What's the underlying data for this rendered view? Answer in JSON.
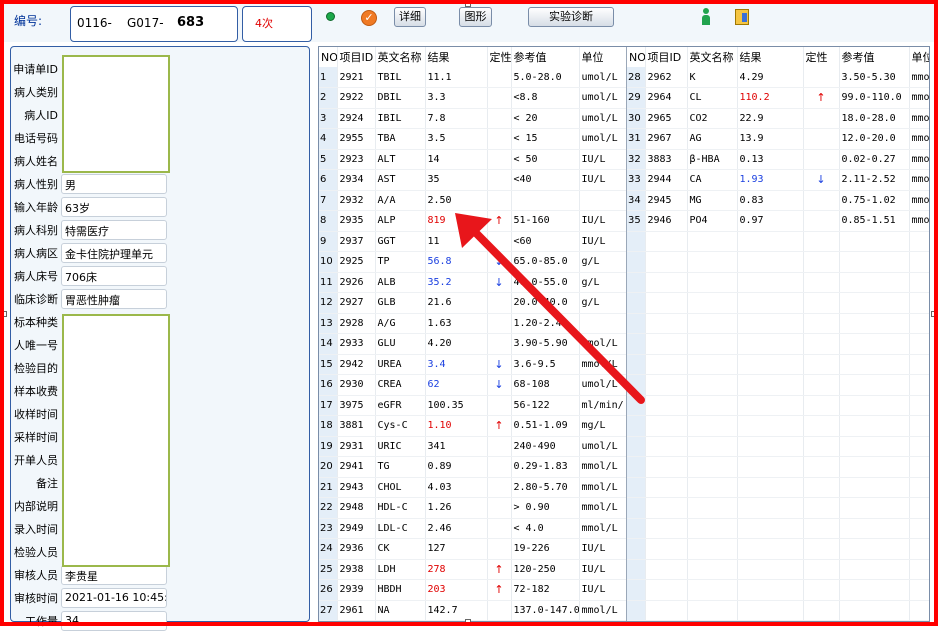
{
  "header": {
    "code_label": "编号:",
    "code_part1": "0116-",
    "code_part2": "G017-",
    "code_part3": "683",
    "count": "4次",
    "detail_button": "详细",
    "graph_button": "图形",
    "diagnosis_button": "实验诊断"
  },
  "patient": {
    "labels": {
      "request_id": "申请单ID",
      "patient_type": "病人类别",
      "patient_id": "病人ID",
      "phone": "电话号码",
      "name": "病人姓名",
      "sex": "病人性别",
      "age": "输入年龄",
      "dept": "病人科别",
      "ward": "病人病区",
      "bed": "病人床号",
      "diagnosis": "临床诊断",
      "specimen": "标本种类",
      "unique_no": "人唯一号",
      "purpose": "检验目的",
      "fee": "样本收费",
      "receive_time": "收样时间",
      "collect_time": "采样时间",
      "issuer": "开单人员",
      "remark": "备注",
      "internal_note": "内部说明",
      "entry_time": "录入时间",
      "tester": "检验人员",
      "reviewer": "审核人员",
      "review_time": "审核时间",
      "workload": "工作量"
    },
    "values": {
      "sex": "男",
      "age": "63岁",
      "dept": "特需医疗",
      "ward": "金卡住院护理单元",
      "bed": "706床",
      "diagnosis": "胃恶性肿瘤",
      "reviewer": "李贵星",
      "review_time": "2021-01-16 10:45:3",
      "workload": "34"
    }
  },
  "table": {
    "headers": [
      "NO",
      "项目ID",
      "英文名称",
      "结果",
      "定性",
      "参考值",
      "单位"
    ],
    "left_rows": [
      {
        "no": "1",
        "id": "2921",
        "name": "TBIL",
        "result": "11.1",
        "flag": "",
        "ref": "5.0-28.0",
        "unit": "umol/L",
        "color": "#000000"
      },
      {
        "no": "2",
        "id": "2922",
        "name": "DBIL",
        "result": "3.3",
        "flag": "",
        "ref": "<8.8",
        "unit": "umol/L",
        "color": "#000000"
      },
      {
        "no": "3",
        "id": "2924",
        "name": "IBIL",
        "result": "7.8",
        "flag": "",
        "ref": "< 20",
        "unit": "umol/L",
        "color": "#000000"
      },
      {
        "no": "4",
        "id": "2955",
        "name": "TBA",
        "result": "3.5",
        "flag": "",
        "ref": "< 15",
        "unit": "umol/L",
        "color": "#000000"
      },
      {
        "no": "5",
        "id": "2923",
        "name": "ALT",
        "result": "14",
        "flag": "",
        "ref": "< 50",
        "unit": "IU/L",
        "color": "#000000"
      },
      {
        "no": "6",
        "id": "2934",
        "name": "AST",
        "result": "35",
        "flag": "",
        "ref": "<40",
        "unit": "IU/L",
        "color": "#000000"
      },
      {
        "no": "7",
        "id": "2932",
        "name": "A/A",
        "result": "2.50",
        "flag": "",
        "ref": "",
        "unit": "",
        "color": "#000000"
      },
      {
        "no": "8",
        "id": "2935",
        "name": "ALP",
        "result": "819",
        "flag": "↑",
        "ref": "51-160",
        "unit": "IU/L",
        "color": "#e00000"
      },
      {
        "no": "9",
        "id": "2937",
        "name": "GGT",
        "result": "11",
        "flag": "",
        "ref": "<60",
        "unit": "IU/L",
        "color": "#000000"
      },
      {
        "no": "10",
        "id": "2925",
        "name": "TP",
        "result": "56.8",
        "flag": "↓",
        "ref": "65.0-85.0",
        "unit": "g/L",
        "color": "#1a3fe0"
      },
      {
        "no": "11",
        "id": "2926",
        "name": "ALB",
        "result": "35.2",
        "flag": "↓",
        "ref": "40.0-55.0",
        "unit": "g/L",
        "color": "#1a3fe0"
      },
      {
        "no": "12",
        "id": "2927",
        "name": "GLB",
        "result": "21.6",
        "flag": "",
        "ref": "20.0-40.0",
        "unit": "g/L",
        "color": "#000000"
      },
      {
        "no": "13",
        "id": "2928",
        "name": "A/G",
        "result": "1.63",
        "flag": "",
        "ref": "1.20-2.40",
        "unit": "",
        "color": "#000000"
      },
      {
        "no": "14",
        "id": "2933",
        "name": "GLU",
        "result": "4.20",
        "flag": "",
        "ref": "3.90-5.90",
        "unit": "mmol/L",
        "color": "#000000"
      },
      {
        "no": "15",
        "id": "2942",
        "name": "UREA",
        "result": "3.4",
        "flag": "↓",
        "ref": "3.6-9.5",
        "unit": "mmol/L",
        "color": "#1a3fe0"
      },
      {
        "no": "16",
        "id": "2930",
        "name": "CREA",
        "result": "62",
        "flag": "↓",
        "ref": "68-108",
        "unit": "umol/L",
        "color": "#1a3fe0"
      },
      {
        "no": "17",
        "id": "3975",
        "name": "eGFR",
        "result": "100.35",
        "flag": "",
        "ref": "56-122",
        "unit": "ml/min/",
        "color": "#000000"
      },
      {
        "no": "18",
        "id": "3881",
        "name": "Cys-C",
        "result": "1.10",
        "flag": "↑",
        "ref": "0.51-1.09",
        "unit": "mg/L",
        "color": "#e00000"
      },
      {
        "no": "19",
        "id": "2931",
        "name": "URIC",
        "result": "341",
        "flag": "",
        "ref": "240-490",
        "unit": "umol/L",
        "color": "#000000"
      },
      {
        "no": "20",
        "id": "2941",
        "name": "TG",
        "result": "0.89",
        "flag": "",
        "ref": "0.29-1.83",
        "unit": "mmol/L",
        "color": "#000000"
      },
      {
        "no": "21",
        "id": "2943",
        "name": "CHOL",
        "result": "4.03",
        "flag": "",
        "ref": "2.80-5.70",
        "unit": "mmol/L",
        "color": "#000000"
      },
      {
        "no": "22",
        "id": "2948",
        "name": "HDL-C",
        "result": "1.26",
        "flag": "",
        "ref": "> 0.90",
        "unit": "mmol/L",
        "color": "#000000"
      },
      {
        "no": "23",
        "id": "2949",
        "name": "LDL-C",
        "result": "2.46",
        "flag": "",
        "ref": "< 4.0",
        "unit": "mmol/L",
        "color": "#000000"
      },
      {
        "no": "24",
        "id": "2936",
        "name": "CK",
        "result": "127",
        "flag": "",
        "ref": "19-226",
        "unit": "IU/L",
        "color": "#000000"
      },
      {
        "no": "25",
        "id": "2938",
        "name": "LDH",
        "result": "278",
        "flag": "↑",
        "ref": "120-250",
        "unit": "IU/L",
        "color": "#e00000"
      },
      {
        "no": "26",
        "id": "2939",
        "name": "HBDH",
        "result": "203",
        "flag": "↑",
        "ref": "72-182",
        "unit": "IU/L",
        "color": "#e00000"
      },
      {
        "no": "27",
        "id": "2961",
        "name": "NA",
        "result": "142.7",
        "flag": "",
        "ref": "137.0-147.0",
        "unit": "mmol/L",
        "color": "#000000"
      }
    ],
    "right_rows": [
      {
        "no": "28",
        "id": "2962",
        "name": "K",
        "result": "4.29",
        "flag": "",
        "ref": "3.50-5.30",
        "unit": "mmol/L",
        "color": "#000000"
      },
      {
        "no": "29",
        "id": "2964",
        "name": "CL",
        "result": "110.2",
        "flag": "↑",
        "ref": "99.0-110.0",
        "unit": "mmol/L",
        "color": "#e00000"
      },
      {
        "no": "30",
        "id": "2965",
        "name": "CO2",
        "result": "22.9",
        "flag": "",
        "ref": "18.0-28.0",
        "unit": "mmol/L",
        "color": "#000000"
      },
      {
        "no": "31",
        "id": "2967",
        "name": "AG",
        "result": "13.9",
        "flag": "",
        "ref": "12.0-20.0",
        "unit": "mmol/L",
        "color": "#000000"
      },
      {
        "no": "32",
        "id": "3883",
        "name": "β-HBA",
        "result": "0.13",
        "flag": "",
        "ref": "0.02-0.27",
        "unit": "mmol/L",
        "color": "#000000"
      },
      {
        "no": "33",
        "id": "2944",
        "name": "CA",
        "result": "1.93",
        "flag": "↓",
        "ref": "2.11-2.52",
        "unit": "mmol/L",
        "color": "#1a3fe0"
      },
      {
        "no": "34",
        "id": "2945",
        "name": "MG",
        "result": "0.83",
        "flag": "",
        "ref": "0.75-1.02",
        "unit": "mmol/L",
        "color": "#000000"
      },
      {
        "no": "35",
        "id": "2946",
        "name": "PO4",
        "result": "0.97",
        "flag": "",
        "ref": "0.85-1.51",
        "unit": "mmol/L",
        "color": "#000000"
      }
    ]
  },
  "colors": {
    "high": "#e00000",
    "low": "#1a3fe0",
    "annotation_arrow": "#e8161b",
    "frame": "#ff0000"
  }
}
